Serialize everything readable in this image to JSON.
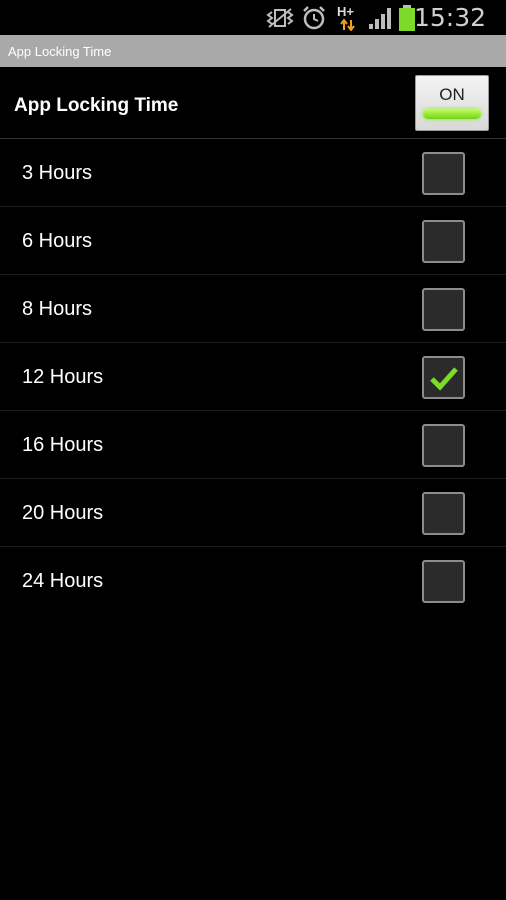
{
  "status_bar": {
    "time": "15:32",
    "network_type": "H+",
    "icons": [
      "vibrate-icon",
      "alarm-icon",
      "network-hplus-icon",
      "signal-icon",
      "battery-icon"
    ]
  },
  "title_bar": {
    "title": "App Locking Time"
  },
  "header": {
    "title": "App Locking Time",
    "toggle_label": "ON",
    "toggle_on": true
  },
  "options": [
    {
      "label": "3 Hours",
      "checked": false
    },
    {
      "label": "6 Hours",
      "checked": false
    },
    {
      "label": "8 Hours",
      "checked": false
    },
    {
      "label": "12 Hours",
      "checked": true
    },
    {
      "label": "16 Hours",
      "checked": false
    },
    {
      "label": "20 Hours",
      "checked": false
    },
    {
      "label": "24 Hours",
      "checked": false
    }
  ],
  "colors": {
    "accent": "#7cdb28",
    "title_bar": "#a9a9a9",
    "background": "#000000"
  }
}
